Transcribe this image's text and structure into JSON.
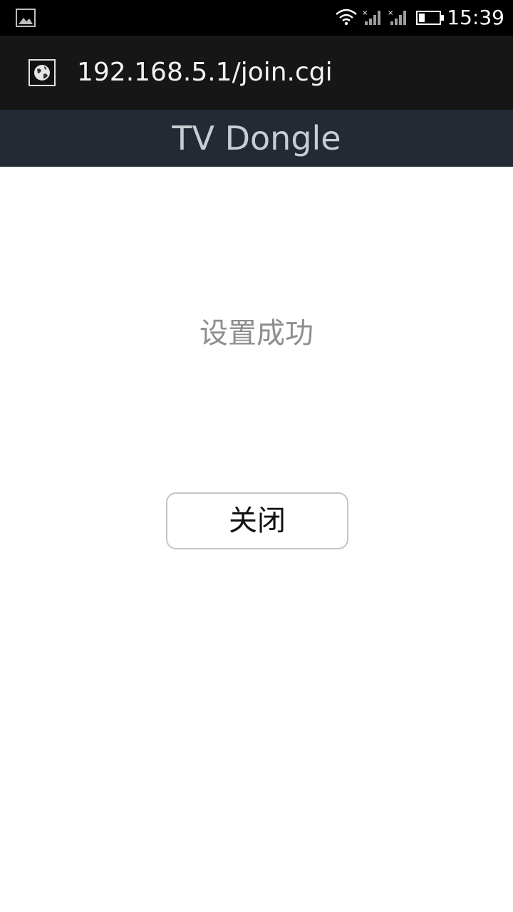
{
  "status_bar": {
    "time": "15:39",
    "left_icon": "image-notification-icon",
    "icons": [
      "wifi-icon",
      "signal-no-service-icon",
      "signal-no-service-icon",
      "battery-low-icon"
    ]
  },
  "browser": {
    "favicon": "globe-icon",
    "url": "192.168.5.1/join.cgi"
  },
  "page": {
    "header_title": "TV Dongle",
    "message": "设置成功",
    "close_button_label": "关闭"
  },
  "colors": {
    "status_bar_bg": "#000000",
    "url_bar_bg": "#161616",
    "header_bg": "#232a33",
    "header_text": "#c9ccd1",
    "message_text": "#8e8e8e"
  }
}
